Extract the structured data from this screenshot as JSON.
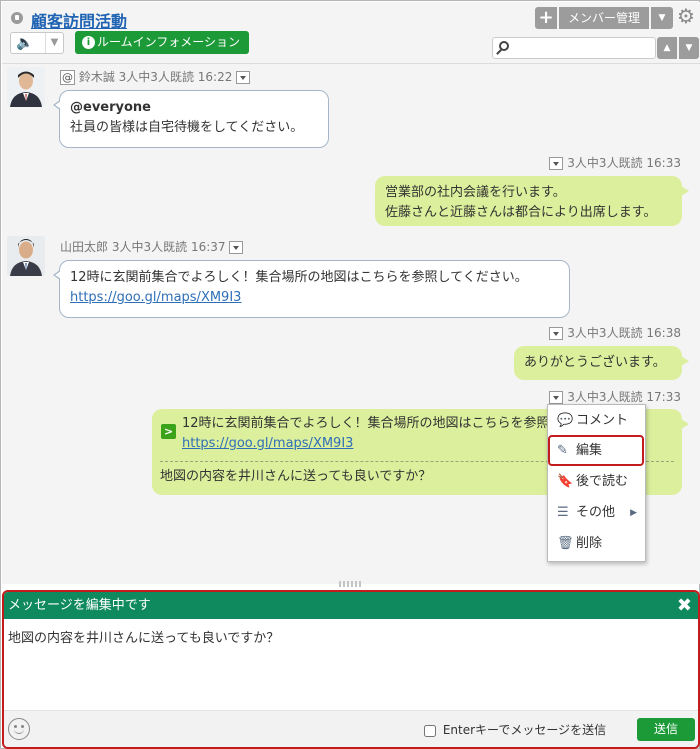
{
  "header": {
    "room_title": "顧客訪問活動",
    "room_info_label": "ルームインフォメーション",
    "member_manage_label": "メンバー管理",
    "search_placeholder": ""
  },
  "messages": [
    {
      "id": "m1",
      "side": "left",
      "sender": "鈴木誠",
      "read_status": "3人中3人既読",
      "time": "16:22",
      "mention": "@everyone",
      "line1": "社員の皆様は自宅待機をしてください。"
    },
    {
      "id": "m2",
      "side": "right",
      "read_status": "3人中3人既読",
      "time": "16:33",
      "line1": "営業部の社内会議を行います。",
      "line2": "佐藤さんと近藤さんは都合により出席します。"
    },
    {
      "id": "m3",
      "side": "left",
      "sender": "山田太郎",
      "read_status": "3人中3人既読",
      "time": "16:37",
      "line1": "12時に玄関前集合でよろしく！集合場所の地図はこちらを参照してください。",
      "link": "https://goo.gl/maps/XM9I3"
    },
    {
      "id": "m4",
      "side": "right",
      "read_status": "3人中3人既読",
      "time": "16:38",
      "line1": "ありがとうございます。"
    },
    {
      "id": "m5",
      "side": "right",
      "read_status": "3人中3人既読",
      "time": "17:33",
      "quote_text": "12時に玄関前集合でよろしく！集合場所の地図はこちらを参照してください。",
      "quote_link": "https://goo.gl/maps/XM9I3",
      "line1": "地図の内容を井川さんに送っても良いですか？"
    }
  ],
  "context_menu": {
    "items": [
      {
        "label": "コメント",
        "icon": "comment-icon"
      },
      {
        "label": "編集",
        "icon": "pencil-icon"
      },
      {
        "label": "後で読む",
        "icon": "bookmark-icon"
      },
      {
        "label": "その他",
        "icon": "list-icon"
      },
      {
        "label": "削除",
        "icon": "trash-icon"
      }
    ]
  },
  "editor": {
    "header_label": "メッセージを編集中です",
    "text": "地図の内容を井川さんに送っても良いですか？",
    "enter_to_send_label": "Enterキーでメッセージを送信",
    "send_label": "送信"
  },
  "colors": {
    "accent_green": "#1c9a38",
    "editor_header": "#0f8a5f",
    "bubble_own": "#dcef9c",
    "highlight_red": "#c21c1c",
    "title_blue": "#1f63b3"
  }
}
